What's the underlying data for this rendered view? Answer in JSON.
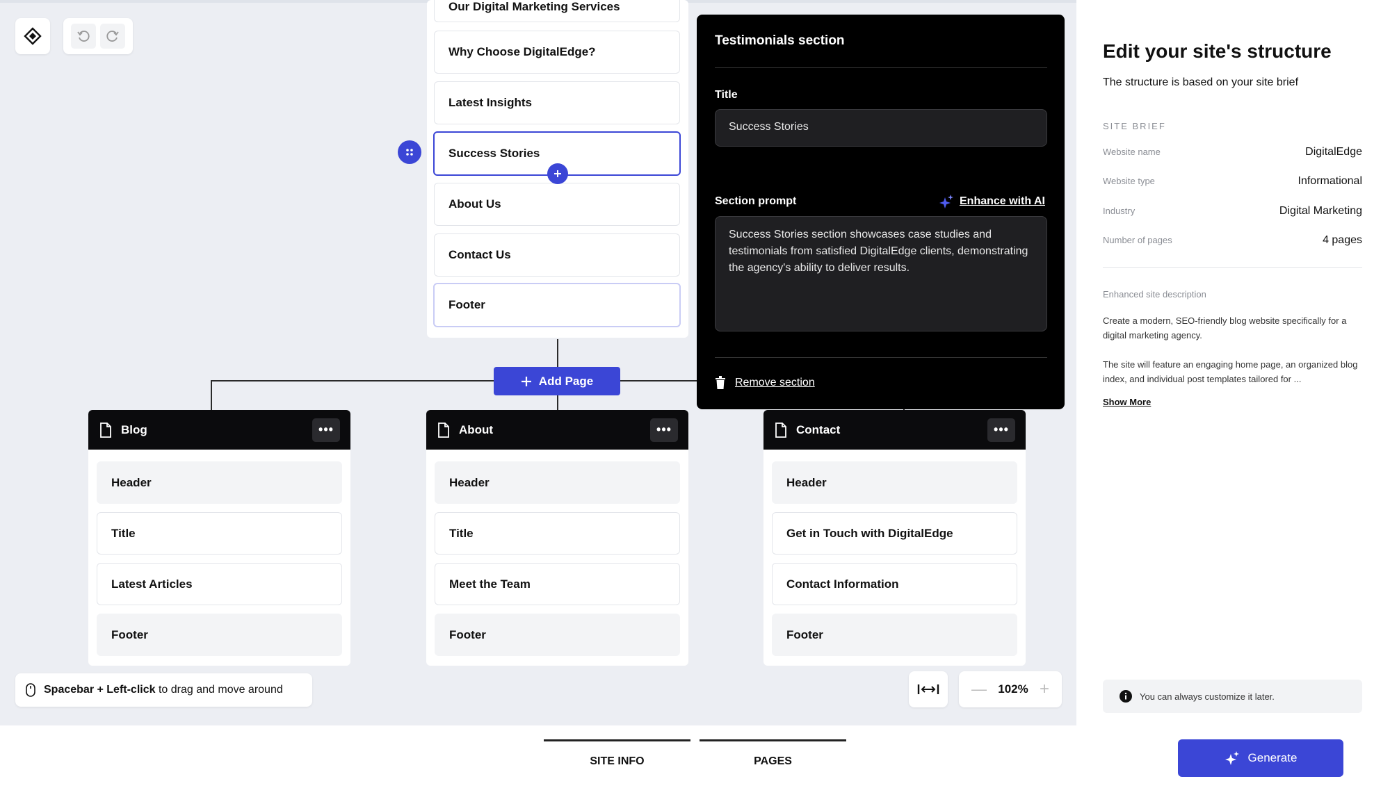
{
  "canvas": {
    "partial_top_section": "Our Digital Marketing Services",
    "home_sections": [
      "Why Choose DigitalEdge?",
      "Latest Insights",
      "Success Stories",
      "About Us",
      "Contact Us",
      "Footer"
    ],
    "add_page_label": "Add Page",
    "pages": [
      {
        "title": "Blog",
        "sections": [
          "Header",
          "Title",
          "Latest Articles",
          "Footer"
        ]
      },
      {
        "title": "About",
        "sections": [
          "Header",
          "Title",
          "Meet the Team",
          "Footer"
        ]
      },
      {
        "title": "Contact",
        "sections": [
          "Header",
          "Get in Touch with DigitalEdge",
          "Contact Information",
          "Footer"
        ]
      }
    ],
    "hint_bold": "Spacebar + Left-click",
    "hint_rest": " to drag and move around",
    "zoom": "102%"
  },
  "editor": {
    "heading": "Testimonials section",
    "title_label": "Title",
    "title_value": "Success Stories",
    "prompt_label": "Section prompt",
    "enhance_label": "Enhance with AI",
    "prompt_value": "Success Stories section showcases case studies and testimonials from satisfied DigitalEdge clients, demonstrating the agency's ability to deliver results.",
    "remove_label": "Remove section"
  },
  "bottom_tabs": [
    "SITE INFO",
    "PAGES"
  ],
  "sidebar": {
    "title": "Edit your site's structure",
    "subtitle": "The structure is based on your site brief",
    "brief_heading": "SITE BRIEF",
    "brief": [
      {
        "label": "Website name",
        "value": "DigitalEdge"
      },
      {
        "label": "Website type",
        "value": "Informational"
      },
      {
        "label": "Industry",
        "value": "Digital Marketing"
      },
      {
        "label": "Number of pages",
        "value": "4 pages"
      }
    ],
    "enhanced_heading": "Enhanced site description",
    "enhanced_p1": "Create a modern, SEO-friendly blog website specifically for a digital marketing agency.",
    "enhanced_p2": "The site will feature an engaging home page, an organized blog index, and individual post templates tailored for ...",
    "show_more": "Show More",
    "note": "You can always customize it later.",
    "generate_label": "Generate"
  },
  "colors": {
    "accent": "#3b46d6",
    "dark": "#000000"
  }
}
